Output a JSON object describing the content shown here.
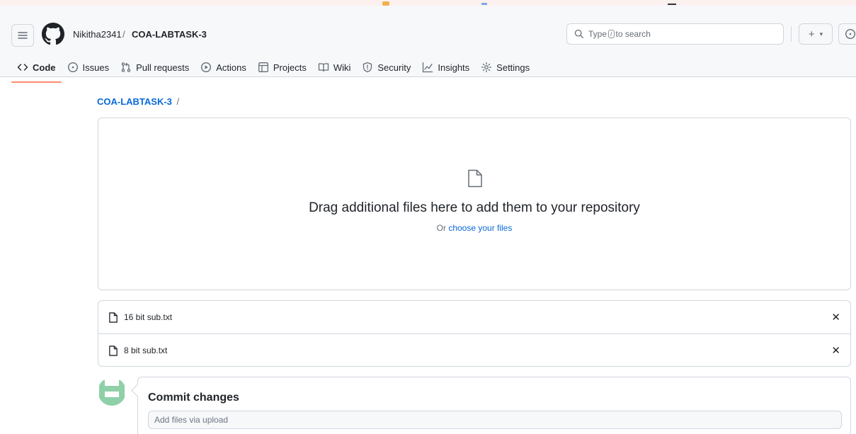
{
  "header": {
    "owner": "Nikitha2341",
    "separator": "/",
    "repo": "COA-LABTASK-3",
    "search": {
      "prefix": "Type",
      "key": "/",
      "suffix": "to search"
    },
    "new_label": "+"
  },
  "tabs": [
    {
      "label": "Code",
      "icon": "code-icon",
      "active": true
    },
    {
      "label": "Issues",
      "icon": "issue-icon"
    },
    {
      "label": "Pull requests",
      "icon": "pull-request-icon"
    },
    {
      "label": "Actions",
      "icon": "play-icon"
    },
    {
      "label": "Projects",
      "icon": "table-icon"
    },
    {
      "label": "Wiki",
      "icon": "book-icon"
    },
    {
      "label": "Security",
      "icon": "shield-icon"
    },
    {
      "label": "Insights",
      "icon": "graph-icon"
    },
    {
      "label": "Settings",
      "icon": "gear-icon"
    }
  ],
  "breadcrumb": {
    "repo": "COA-LABTASK-3",
    "slash": "/"
  },
  "dropzone": {
    "title": "Drag additional files here to add them to your repository",
    "sub_prefix": "Or",
    "sub_link": "choose your files"
  },
  "files": [
    {
      "name": "16 bit sub.txt"
    },
    {
      "name": "8 bit sub.txt"
    }
  ],
  "commit": {
    "title": "Commit changes",
    "message_placeholder": "Add files via upload"
  },
  "colors": {
    "accent_link": "#0969da",
    "active_tab_underline": "#fd8c73",
    "border": "#d0d7de",
    "header_bg": "#f6f8fa",
    "avatar": "#8fd0a8"
  }
}
